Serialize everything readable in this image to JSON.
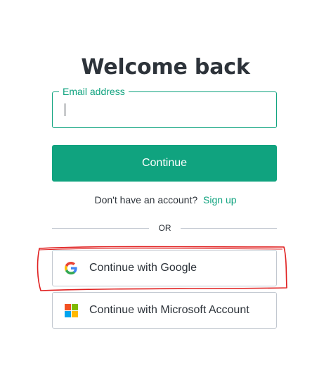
{
  "page": {
    "title": "Welcome back"
  },
  "email": {
    "label": "Email address",
    "value": "",
    "placeholder": ""
  },
  "continue_button": {
    "label": "Continue"
  },
  "signup": {
    "prompt": "Don't have an account?",
    "link_label": "Sign up"
  },
  "divider": {
    "label": "OR"
  },
  "social": {
    "google": {
      "label": "Continue with Google",
      "icon": "google-icon"
    },
    "microsoft": {
      "label": "Continue with Microsoft Account",
      "icon": "microsoft-icon"
    }
  },
  "colors": {
    "accent": "#10a37f",
    "text": "#2d333a",
    "border": "#c2c8d0",
    "annotation": "#e02020"
  }
}
